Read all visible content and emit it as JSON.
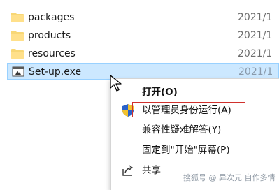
{
  "files": [
    {
      "name": "packages",
      "date": "2021/1",
      "icon": "folder-icon",
      "selected": false
    },
    {
      "name": "products",
      "date": "2021/1",
      "icon": "folder-icon",
      "selected": false
    },
    {
      "name": "resources",
      "date": "2021/1",
      "icon": "folder-icon",
      "selected": false
    },
    {
      "name": "Set-up.exe",
      "date": "2021/1",
      "icon": "exe-file-icon",
      "selected": true
    }
  ],
  "context_menu": {
    "items": [
      {
        "label": "打开(O)",
        "bold": true,
        "icon": ""
      },
      {
        "label": "以管理员身份运行(A)",
        "bold": false,
        "icon": "uac-shield-icon",
        "highlighted": true
      },
      {
        "label": "兼容性疑难解答(Y)",
        "bold": false,
        "icon": ""
      },
      {
        "label": "固定到\"开始\"屏幕(P)",
        "bold": false,
        "icon": ""
      },
      {
        "label": "共享",
        "bold": false,
        "icon": "share-icon"
      }
    ]
  },
  "watermark": "搜狐号 @ 异次元 自作多情",
  "colors": {
    "selection_bg": "#cce8ff",
    "selection_border": "#99d1ff",
    "highlight_box": "#d0312d",
    "folder_yellow": "#f8d775"
  }
}
